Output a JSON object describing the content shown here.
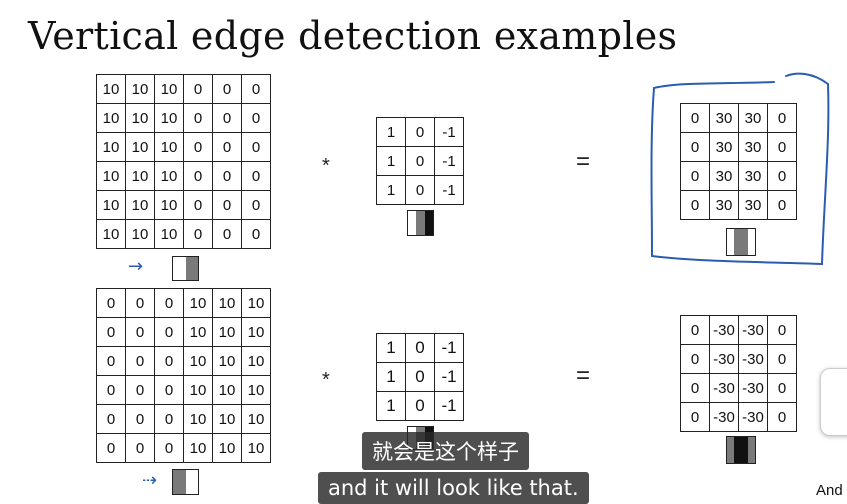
{
  "slide": {
    "title": "Vertical edge detection examples",
    "example1": {
      "input": [
        [
          "10",
          "10",
          "10",
          "0",
          "0",
          "0"
        ],
        [
          "10",
          "10",
          "10",
          "0",
          "0",
          "0"
        ],
        [
          "10",
          "10",
          "10",
          "0",
          "0",
          "0"
        ],
        [
          "10",
          "10",
          "10",
          "0",
          "0",
          "0"
        ],
        [
          "10",
          "10",
          "10",
          "0",
          "0",
          "0"
        ],
        [
          "10",
          "10",
          "10",
          "0",
          "0",
          "0"
        ]
      ],
      "operator": "*",
      "filter": [
        [
          "1",
          "0",
          "-1"
        ],
        [
          "1",
          "0",
          "-1"
        ],
        [
          "1",
          "0",
          "-1"
        ]
      ],
      "equals": "=",
      "output": [
        [
          "0",
          "30",
          "30",
          "0"
        ],
        [
          "0",
          "30",
          "30",
          "0"
        ],
        [
          "0",
          "30",
          "30",
          "0"
        ],
        [
          "0",
          "30",
          "30",
          "0"
        ]
      ]
    },
    "example2": {
      "input": [
        [
          "0",
          "0",
          "0",
          "10",
          "10",
          "10"
        ],
        [
          "0",
          "0",
          "0",
          "10",
          "10",
          "10"
        ],
        [
          "0",
          "0",
          "0",
          "10",
          "10",
          "10"
        ],
        [
          "0",
          "0",
          "0",
          "10",
          "10",
          "10"
        ],
        [
          "0",
          "0",
          "0",
          "10",
          "10",
          "10"
        ],
        [
          "0",
          "0",
          "0",
          "10",
          "10",
          "10"
        ]
      ],
      "operator": "*",
      "filter": [
        [
          "1",
          "0",
          "-1"
        ],
        [
          "1",
          "0",
          "-1"
        ],
        [
          "1",
          "0",
          "-1"
        ]
      ],
      "equals": "=",
      "output": [
        [
          "0",
          "-30",
          "-30",
          "0"
        ],
        [
          "0",
          "-30",
          "-30",
          "0"
        ],
        [
          "0",
          "-30",
          "-30",
          "0"
        ],
        [
          "0",
          "-30",
          "-30",
          "0"
        ]
      ]
    }
  },
  "subtitles": {
    "chinese": "就会是这个样子",
    "english": "and it will look like that."
  },
  "corner_text": "And",
  "colors": {
    "annotation_blue": "#2a5db0",
    "swatch_gray": "#7a7a7a",
    "swatch_dark": "#111111",
    "subtitle_bg": "#2b2b2b"
  },
  "icons": {
    "arrow": "right-arrow-icon",
    "dashed_arrow": "dashed-right-arrow-icon"
  }
}
